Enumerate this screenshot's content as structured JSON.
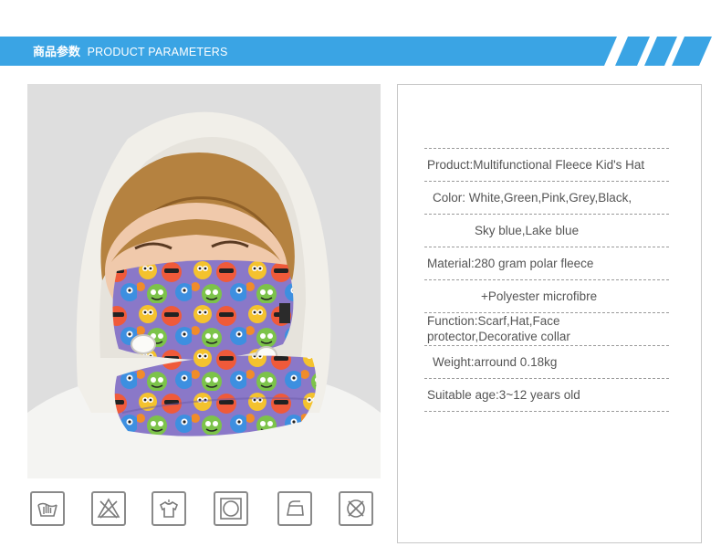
{
  "banner": {
    "title_cn": "商品参数",
    "title_en": "PRODUCT PARAMETERS",
    "color": "#3aa4e4"
  },
  "photo": {
    "alt_subject": "child-wearing-fleece-hood"
  },
  "care_icons": [
    "hand-wash-icon",
    "do-not-bleach-icon",
    "hang-dry-icon",
    "tumble-dry-icon",
    "iron-icon",
    "do-not-dry-clean-icon"
  ],
  "parameters": {
    "product": "Product:Multifunctional Fleece Kid's Hat",
    "color_line1": "Color:  White,Green,Pink,Grey,Black,",
    "color_line2": "Sky blue,Lake blue",
    "material_line1": "Material:280 gram polar fleece",
    "material_line2": "+Polyester microfibre",
    "function": "Function:Scarf,Hat,Face protector,Decorative collar",
    "weight": "Weight:arround 0.18kg",
    "age": "Suitable age:3~12 years old"
  }
}
